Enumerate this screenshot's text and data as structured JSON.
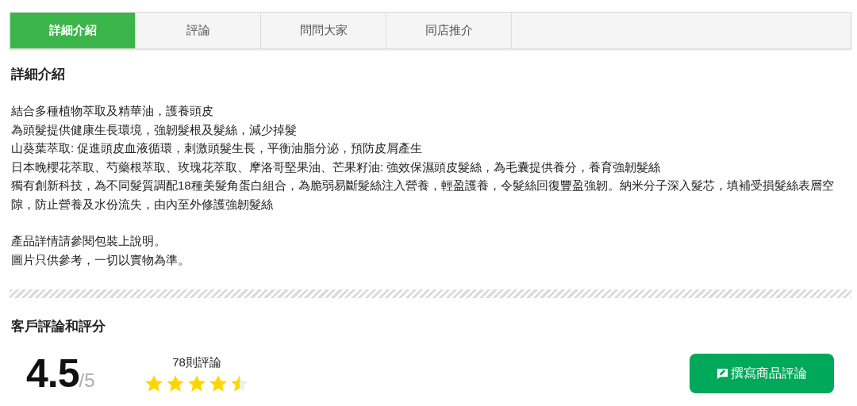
{
  "tabs": [
    {
      "label": "詳細介紹",
      "selected": true
    },
    {
      "label": "評論",
      "selected": false
    },
    {
      "label": "問問大家",
      "selected": false
    },
    {
      "label": "同店推介",
      "selected": false
    }
  ],
  "details": {
    "title": "詳細介紹",
    "paragraphs": [
      [
        "結合多種植物萃取及精華油，護養頭皮",
        "為頭髮提供健康生長環境，強韌髮根及髮絲，減少掉髮",
        "山葵葉萃取: 促進頭皮血液循環，刺激頭髮生長，平衡油脂分泌，預防皮屑產生",
        "日本晚櫻花萃取、芍藥根萃取、玫瑰花萃取、摩洛哥堅果油、芒果籽油: 強效保濕頭皮髮絲，為毛囊提供養分，養育強韌髮絲",
        "獨有創新科技，為不同髮質調配18種美髮角蛋白組合，為脆弱易斷髮絲注入營養，輕盈護養，令髮絲回復豐盈強韌。納米分子深入髮芯，填補受損髮絲表層空隙，防止營養及水份流失，由內至外修護強韌髮絲"
      ],
      [
        "產品詳情請參閱包裝上說明。",
        "圖片只供參考，一切以實物為準。"
      ]
    ]
  },
  "reviews": {
    "title": "客戶評論和評分",
    "score": "4.5",
    "out_of": "/5",
    "count": "78則評論",
    "stars": 4.5,
    "write_button": "撰寫商品評論"
  }
}
